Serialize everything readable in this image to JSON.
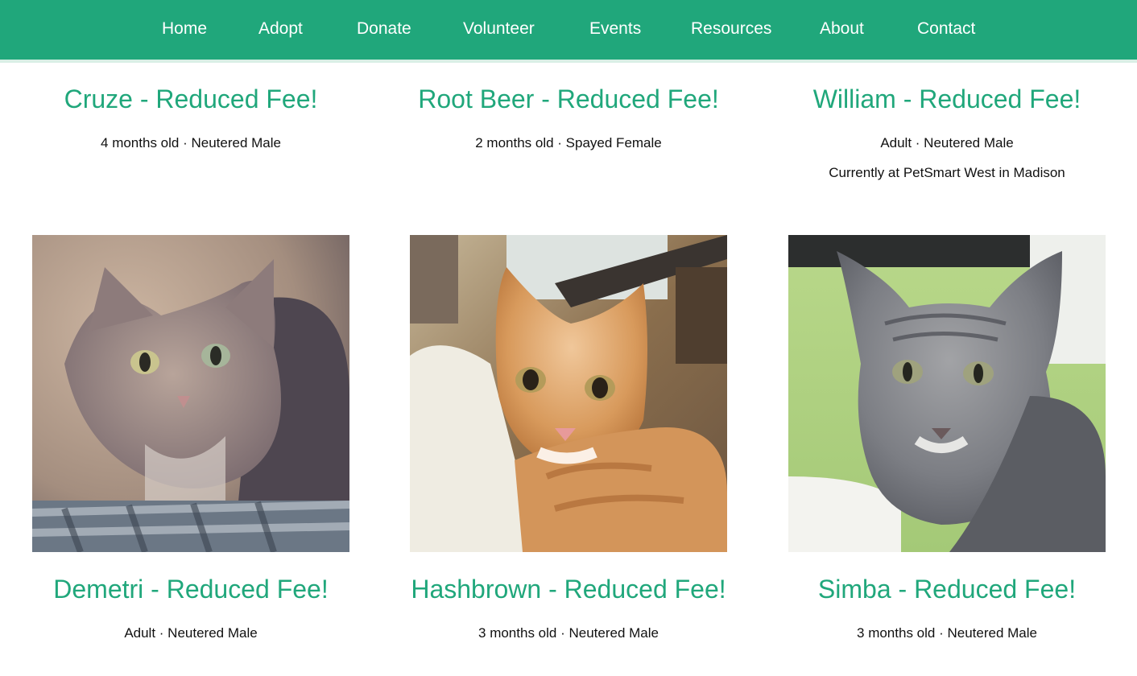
{
  "nav": {
    "items": [
      "Home",
      "Adopt",
      "Donate",
      "Volunteer",
      "Events",
      "Resources",
      "About",
      "Contact"
    ]
  },
  "pets_row1": [
    {
      "name": "Cruze - Reduced Fee!",
      "info": "4 months old · Neutered Male",
      "location": ""
    },
    {
      "name": "Root Beer - Reduced Fee!",
      "info": "2 months old · Spayed Female",
      "location": ""
    },
    {
      "name": "William - Reduced Fee!",
      "info": "Adult · Neutered Male",
      "location": "Currently at PetSmart West in Madison"
    }
  ],
  "pets_row2": [
    {
      "name": "Demetri - Reduced Fee!",
      "info": "Adult · Neutered Male",
      "photo": "gray-tabby-cat-photo"
    },
    {
      "name": "Hashbrown - Reduced Fee!",
      "info": "3 months old · Neutered Male",
      "photo": "orange-tabby-kitten-photo"
    },
    {
      "name": "Simba - Reduced Fee!",
      "info": "3 months old · Neutered Male",
      "photo": "gray-tabby-kitten-photo"
    }
  ],
  "colors": {
    "brand_green": "#20a77b",
    "text": "#111111"
  }
}
